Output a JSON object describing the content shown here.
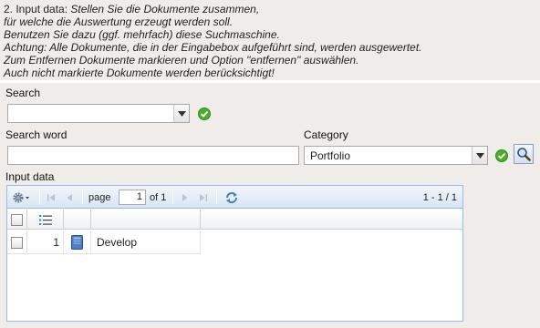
{
  "instructions": {
    "step_prefix": "2. Input data: ",
    "lines": [
      "Stellen Sie die Dokumente zusammen,",
      "für welche die Auswertung erzeugt werden soll.",
      "Benutzen Sie dazu (ggf. mehrfach) diese Suchmaschine.",
      "Achtung: Alle Dokumente, die in der Eingabebox aufgeführt sind, werden ausgewertet.",
      "Zum Entfernen Dokumente markieren und Option \"entfernen\" auswählen.",
      "Auch nicht markierte Dokumente werden berücksichtigt!"
    ]
  },
  "search": {
    "label": "Search",
    "value": ""
  },
  "search_word": {
    "label": "Search word",
    "value": ""
  },
  "category": {
    "label": "Category",
    "value": "Portfolio"
  },
  "input_data": {
    "label": "Input data",
    "pager": {
      "page_label": "page",
      "page_value": "1",
      "of_label": "of 1",
      "range": "1 - 1 / 1"
    },
    "rows": [
      {
        "number": "1",
        "name": "Develop"
      }
    ]
  },
  "colors": {
    "grid_border": "#99bbe8",
    "toolbar_top": "#f2f6fb",
    "toolbar_bottom": "#d9e5f4",
    "ok_green": "#4caf2c",
    "background": "#f0ecea"
  }
}
